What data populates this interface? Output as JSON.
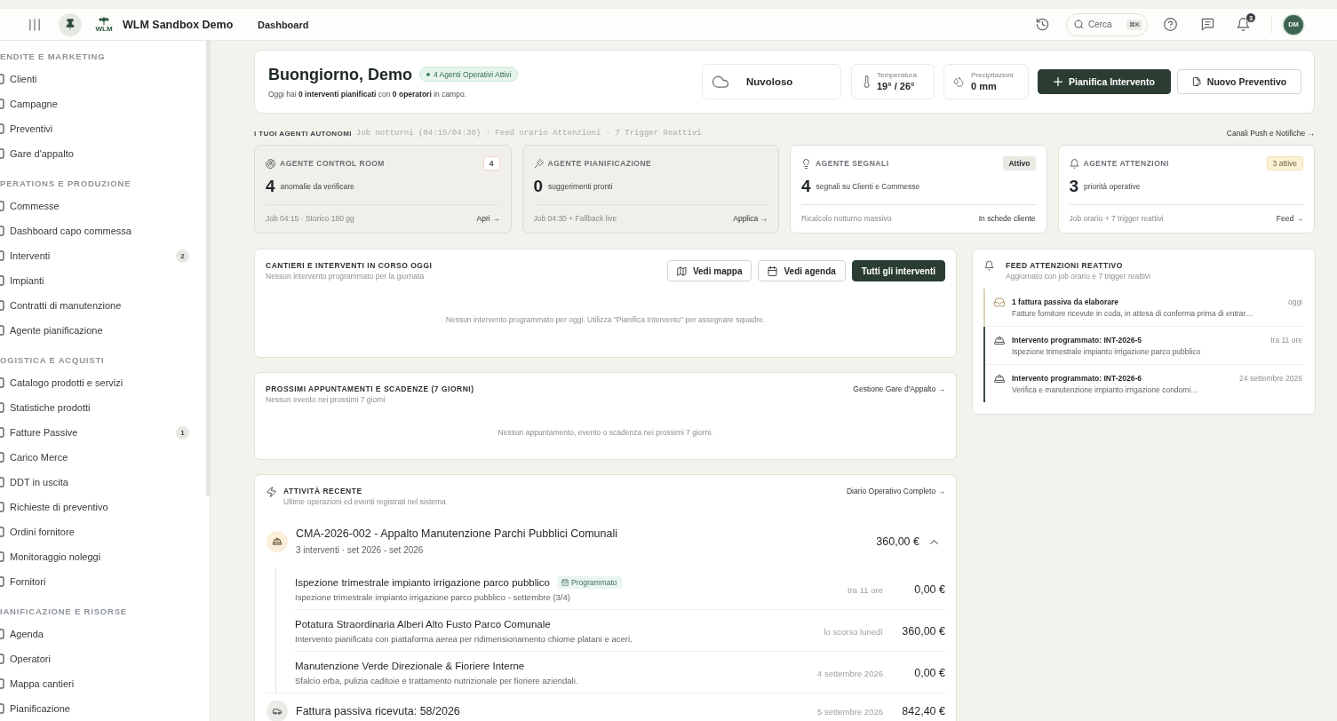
{
  "topbar": {
    "app_name": "WLM Sandbox Demo",
    "logo_text": "WLM",
    "page_title": "Dashboard",
    "search": {
      "placeholder": "Cerca",
      "shortcut": "⌘K"
    },
    "notification_count": "3",
    "avatar_initials": "DM"
  },
  "sidebar": {
    "sections": [
      {
        "title": "ENDITE E MARKETING",
        "items": [
          {
            "label": "Clienti"
          },
          {
            "label": "Campagne"
          },
          {
            "label": "Preventivi"
          },
          {
            "label": "Gare d'appalto"
          }
        ]
      },
      {
        "title": "PERATIONS E PRODUZIONE",
        "items": [
          {
            "label": "Commesse"
          },
          {
            "label": "Dashboard capo commessa"
          },
          {
            "label": "Interventi",
            "badge": "2"
          },
          {
            "label": "Impianti"
          },
          {
            "label": "Contratti di manutenzione"
          },
          {
            "label": "Agente pianificazione"
          }
        ]
      },
      {
        "title": "OGISTICA E ACQUISTI",
        "items": [
          {
            "label": "Catalogo prodotti e servizi"
          },
          {
            "label": "Statistiche prodotti"
          },
          {
            "label": "Fatture Passive",
            "badge": "1"
          },
          {
            "label": "Carico Merce"
          },
          {
            "label": "DDT in uscita"
          },
          {
            "label": "Richieste di preventivo"
          },
          {
            "label": "Ordini fornitore"
          },
          {
            "label": "Monitoraggio noleggi"
          },
          {
            "label": "Fornitori"
          }
        ]
      },
      {
        "title": "IANIFICAZIONE E RISORSE",
        "items": [
          {
            "label": "Agenda"
          },
          {
            "label": "Operatori"
          },
          {
            "label": "Mappa cantieri"
          },
          {
            "label": "Pianificazione"
          }
        ]
      }
    ]
  },
  "greeting": {
    "title": "Buongiorno, Demo",
    "badge": "4 Agenti Operativi Attivi",
    "summary": "Oggi hai **0 interventi pianificati** con **0 operatori** in campo.",
    "weather": "Nuvoloso",
    "stats": [
      {
        "label": "Temperatura",
        "value": "19° / 26°"
      },
      {
        "label": "Precipitazioni",
        "value": "0 mm"
      }
    ],
    "buttons": [
      {
        "label": "Pianifica Intervento",
        "kind": "primary"
      },
      {
        "label": "Nuovo Preventivo",
        "kind": "secondary"
      }
    ]
  },
  "agents": {
    "title": "I TUOI AGENTI AUTONOMI",
    "schedule": "Job notturni (04:15/04:30) · Feed orario Attenzioni · 7 Trigger Reattivi",
    "link": "Canali Push e Notifiche →",
    "cards": [
      {
        "title": "AGENTE CONTROL ROOM",
        "shaded": true,
        "badge": {
          "text": "4",
          "kind": "count"
        },
        "value": "4",
        "description": "anomalie da verificare",
        "footer": "Job 04:15 · Storico 180 gg",
        "action": "Apri →"
      },
      {
        "title": "AGENTE PIANIFICAZIONE",
        "shaded": true,
        "value": "0",
        "description": "suggerimenti pronti",
        "footer": "Job 04:30 + Fallback live",
        "action": "Applica →"
      },
      {
        "title": "AGENTE SEGNALI",
        "shaded": false,
        "badge": {
          "text": "Attivo",
          "kind": "neutral"
        },
        "value": "4",
        "description": "segnali su Clienti e Commesse",
        "footer": "Ricalcolo notturno massivo",
        "action": "In schede cliente"
      },
      {
        "title": "AGENTE ATTENZIONI",
        "shaded": false,
        "badge": {
          "text": "3 attive",
          "kind": "warning"
        },
        "value": "3",
        "description": "priorità operative",
        "footer": "Job orario + 7 trigger reattivi",
        "action": "Feed →"
      }
    ]
  },
  "today": {
    "title": "CANTIERI E INTERVENTI IN CORSO OGGI",
    "subtitle": "Nessun intervento programmato per la giornata",
    "buttons": [
      {
        "label": "Vedi mappa",
        "kind": "outline"
      },
      {
        "label": "Vedi agenda",
        "kind": "outline"
      },
      {
        "label": "Tutti gli interventi",
        "kind": "primary"
      }
    ],
    "empty_message": "Nessun intervento programmato per oggi. Utilizza \"Pianifica Intervento\" per assegnare squadre."
  },
  "upcoming": {
    "title": "PROSSIMI APPUNTAMENTI E SCADENZE (7 GIORNI)",
    "subtitle": "Nessun evento nei prossimi 7 giorni",
    "link": "Gestione Gare d'Appalto →",
    "empty_message": "Nessun appuntamento, evento o scadenza nei prossimi 7 giorni."
  },
  "feed": {
    "title": "FEED ATTENZIONI REATTIVO",
    "subtitle": "Aggiornato con job orario e 7 trigger reattivi",
    "items": [
      {
        "kind": "invoice",
        "color": "#ddd3b8",
        "title": "1 fattura passiva da elaborare",
        "description": "Fatture fornitore ricevute in coda, in attesa di conferma prima di entrar…",
        "time": "oggi"
      },
      {
        "kind": "intervention",
        "color": "#3b4a41",
        "title": "Intervento programmato: INT-2026-5",
        "description": "Ispezione trimestrale impianto irrigazione parco pubblico",
        "time": "tra 11 ore"
      },
      {
        "kind": "intervention",
        "color": "#3b4a41",
        "title": "Intervento programmato: INT-2026-6",
        "description": "Verifica e manutenzione impianto irrigazione condomi…",
        "time": "24 settembre 2026"
      }
    ]
  },
  "activity": {
    "title": "ATTIVITÀ RECENTE",
    "subtitle": "Ultime operazioni ed eventi registrati nel sistema",
    "link": "Diario Operativo Completo →",
    "groups": [
      {
        "kind": "contract",
        "title": "CMA-2026-002 - Appalto Manutenzione Parchi Pubblici Comunali",
        "meta": "3 interventi · set 2026 - set 2026",
        "amount": "360,00 €",
        "expanded": true,
        "children": [
          {
            "title": "Ispezione trimestrale impianto irrigazione parco pubblico",
            "tag": "Programmato",
            "description": "Ispezione trimestrale impianto irrigazione parco pubblico - settembre (3/4)",
            "time": "tra 11 ore",
            "amount": "0,00 €"
          },
          {
            "title": "Potatura Straordinaria Alberi Alto Fusto Parco Comunale",
            "description": "Intervento pianificato con piattaforma aerea per ridimensionamento chiome platani e aceri.",
            "time": "lo scorso lunedì",
            "amount": "360,00 €"
          },
          {
            "title": "Manutenzione Verde Direzionale & Fioriere Interne",
            "description": "Sfalcio erba, pulizia caditoie e trattamento nutrizionale per fioriere aziendali.",
            "time": "4 settembre 2026",
            "amount": "0,00 €"
          }
        ]
      },
      {
        "kind": "invoice",
        "title": "Fattura passiva ricevuta: 58/2026",
        "time": "5 settembre 2026",
        "amount": "842,40 €"
      }
    ]
  }
}
